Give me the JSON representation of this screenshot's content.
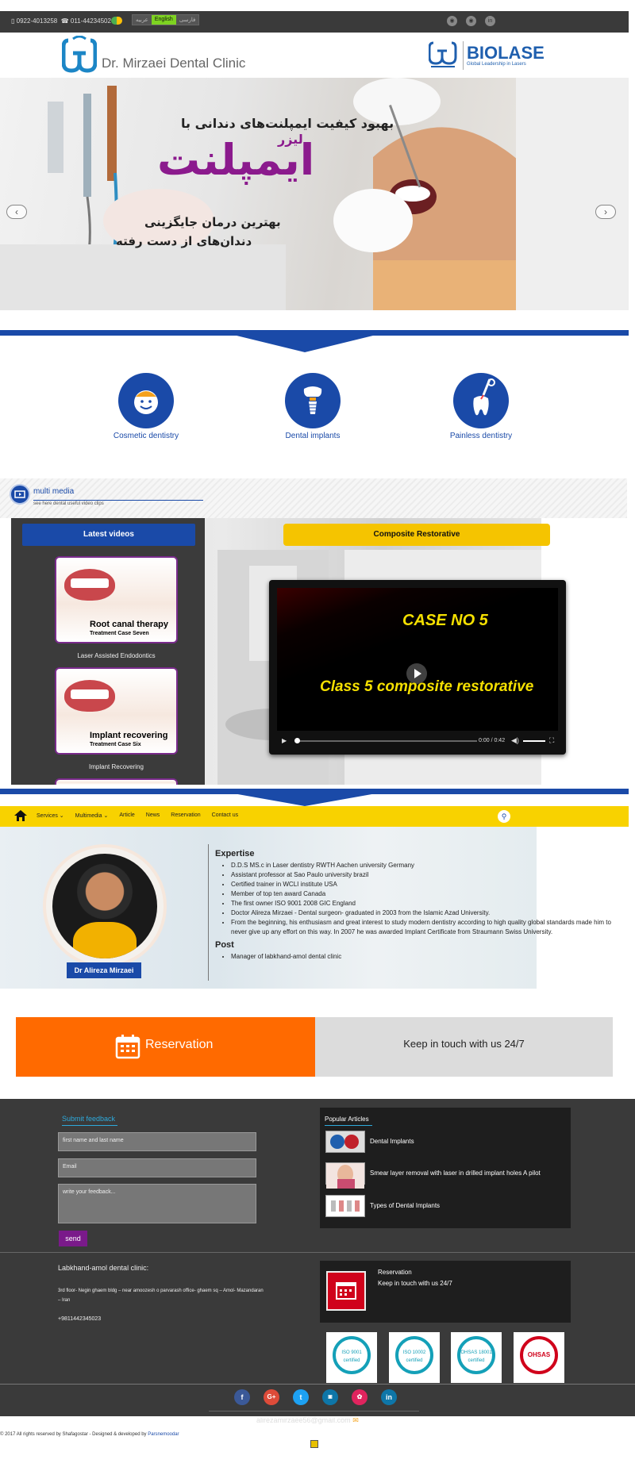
{
  "topbar": {
    "phone1": "0922-4013258",
    "phone2": "011-44234502",
    "languages": [
      "عربیه",
      "English",
      "فارسی"
    ],
    "social": [
      "social-icon-1",
      "social-icon-2",
      "linkedin-icon"
    ]
  },
  "header": {
    "clinic_name": "Dr. Mirzaei Dental Clinic",
    "partner_brand": "BIOLASE",
    "partner_tagline": "Global Leadership in Lasers"
  },
  "hero": {
    "line1": "بهبود کیفیت ایمپلنت‌های دندانی با",
    "line2": "لیزر",
    "headline": "ایمپلنت",
    "line3": "بهترین درمان جایگزینی",
    "line4": "دندان‌های از دست رفته",
    "prev": "‹",
    "next": "›"
  },
  "services": [
    {
      "label": "Cosmetic dentistry",
      "icon": "smile-face-icon"
    },
    {
      "label": "Dental implants",
      "icon": "implant-tooth-icon"
    },
    {
      "label": "Painless dentistry",
      "icon": "laser-tooth-icon"
    }
  ],
  "multimedia": {
    "title": "multi media",
    "subtitle": "see here dental useful video clips",
    "latest_label": "Latest videos",
    "composite_label": "Composite Restorative",
    "videos": [
      {
        "title": "Root canal therapy",
        "subtitle": "Treatment Case Seven",
        "caption": "Laser Assisted Endodontics"
      },
      {
        "title": "Implant recovering",
        "subtitle": "Treatment Case Six",
        "caption": "Implant Recovering"
      }
    ],
    "player": {
      "case": "CASE NO 5",
      "caption": "Class 5 composite restorative",
      "time": "0:00 / 0:42",
      "progress": 0
    }
  },
  "nav": {
    "items": [
      "Services ⌄",
      "Multimedia ⌄",
      "Article",
      "News",
      "Reservation",
      "Contact us"
    ]
  },
  "doctor": {
    "name": "Dr Alireza Mirzaei",
    "expertise_heading": "Expertise",
    "expertise": [
      "D.D.S MS.c in Laser dentistry RWTH Aachen university Germany",
      "Assistant professor at Sao Paulo university brazil",
      "Certified trainer in WCLI institute USA",
      "Member of top ten award Canada",
      "The first owner ISO 9001 2008 GIC England",
      "Doctor Alireza Mirzaei - Dental surgeon- graduated in 2003 from the Islamic Azad University.",
      "From the beginning, his enthusiasm and great interest to study modern dentistry according to high quality global standards made him to never give up any effort on this way. In 2007 he was awarded Implant Certificate from Straumann Swiss University."
    ],
    "post_heading": "Post",
    "post": [
      "Manager of labkhand-amol dental clinic"
    ]
  },
  "cta": {
    "reservation": "Reservation",
    "keep_in_touch": "Keep in touch with us 24/7"
  },
  "footer": {
    "feedback_title": "Submit feedback",
    "name_placeholder": "first name and last name",
    "email_placeholder": "Email",
    "feedback_placeholder": "write your feedback...",
    "send": "send",
    "popular_title": "Popular Articles",
    "articles": [
      "Dental Implants",
      "Smear layer removal with laser in drilled implant holes A pilot",
      "Types of Dental Implants"
    ],
    "address_heading": "Labkhand-amol dental clinic:",
    "address": "3rd floor- Negin ghaem bldg – near amoozesh o parvarash office- ghaem sq – Amol- Mazandaran – Iran",
    "phone": "+9811442345023",
    "res_title": "Reservation",
    "res_sub": "Keep in touch with us 24/7",
    "certs": [
      "ISO 9001 certified",
      "ISO 10002 certified",
      "OHSAS 18001 certified",
      "OHSAS"
    ],
    "social": [
      "f",
      "G+",
      "t",
      "in-box",
      "flickr",
      "in"
    ],
    "email": "alirezamirzaee56@gmail.com",
    "copyright": "© 2017 All rights reserved by Shafagostar - Designed & developed by ",
    "developer": "Parsnemoodar"
  }
}
